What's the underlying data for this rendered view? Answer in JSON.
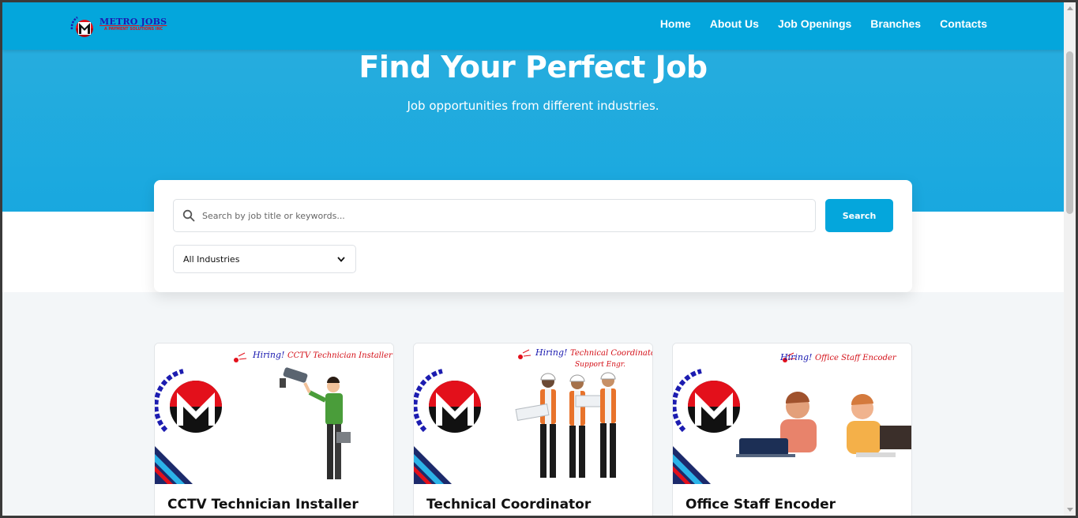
{
  "brand": {
    "name": "METRO JOBS",
    "tagline": "A PAYMENT SOLUTIONS INC",
    "arc_text": "JOBS",
    "primary_color": "#04a6dc",
    "logo_red": "#e3101b",
    "logo_blue": "#1c1cb0"
  },
  "nav": {
    "items": [
      {
        "label": "Home"
      },
      {
        "label": "About Us"
      },
      {
        "label": "Job Openings"
      },
      {
        "label": "Branches"
      },
      {
        "label": "Contacts"
      }
    ]
  },
  "hero": {
    "title": "Find Your Perfect Job",
    "subtitle": "Job opportunities from different industries."
  },
  "search": {
    "placeholder": "Search by job title or keywords...",
    "button_label": "Search",
    "industry_selected": "All Industries"
  },
  "jobs": [
    {
      "title": "CCTV Technician Installer",
      "banner_hiring": "Hiring!",
      "banner_role": "CCTV Technician Installer",
      "banner_role_2": ""
    },
    {
      "title": "Technical Coordinator",
      "banner_hiring": "Hiring!",
      "banner_role": "Technical Coordinator",
      "banner_role_2": "Support Engr."
    },
    {
      "title": "Office Staff Encoder",
      "banner_hiring": "Hiring!",
      "banner_role": "Office Staff Encoder",
      "banner_role_2": ""
    }
  ],
  "card_logo_text": "METRO JOBS"
}
